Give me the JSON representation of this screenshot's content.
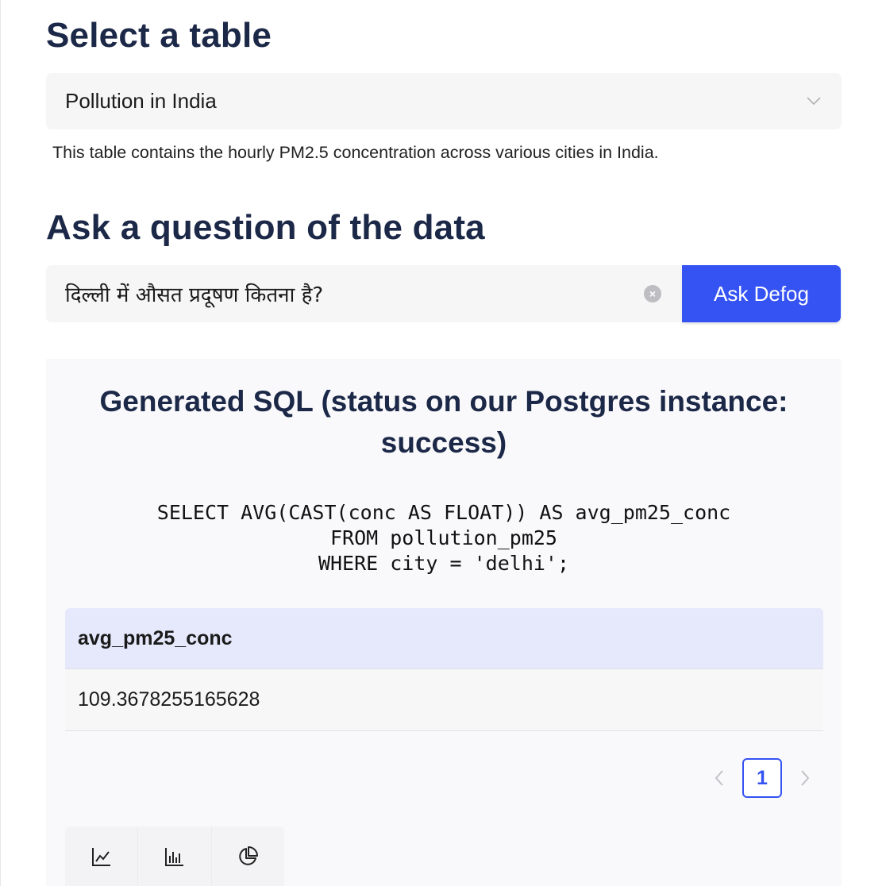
{
  "select_section": {
    "title": "Select a table",
    "selected_value": "Pollution in India",
    "description": "This table contains the hourly PM2.5 concentration across various cities in India."
  },
  "ask_section": {
    "title": "Ask a question of the data",
    "query": "दिल्ली में औसत प्रदूषण कितना है?",
    "ask_button_label": "Ask Defog"
  },
  "result": {
    "title": "Generated SQL (status on our Postgres instance: success)",
    "sql_lines": [
      "SELECT AVG(CAST(conc AS FLOAT)) AS avg_pm25_conc",
      "FROM pollution_pm25",
      "WHERE city = 'delhi';"
    ],
    "table": {
      "columns": [
        "avg_pm25_conc"
      ],
      "rows": [
        [
          "109.3678255165628"
        ]
      ]
    },
    "pagination": {
      "current_page": "1"
    },
    "chart_buttons": [
      "line-chart-icon",
      "bar-chart-icon",
      "pie-chart-icon"
    ]
  },
  "colors": {
    "accent": "#3553f3",
    "heading": "#1c2847",
    "table_header_bg": "#e5e9fb"
  }
}
